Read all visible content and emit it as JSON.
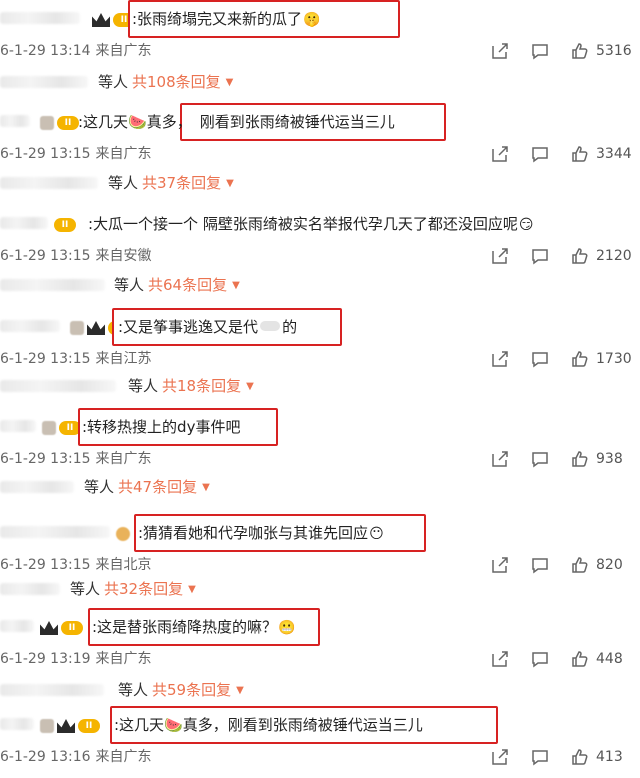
{
  "comments": [
    {
      "text": ":张雨绮塌完又来新的瓜了",
      "emoji": "🤫",
      "date": "6-1-29 13:14",
      "source": "来自广东",
      "likes": "5316",
      "reply_prefix": "等人",
      "reply_count": "共108条回复"
    },
    {
      "text": ":这几天🍉真多，",
      "highlight": "刚看到张雨绮被锤代运当三儿",
      "date": "6-1-29 13:15",
      "source": "来自广东",
      "likes": "3344",
      "reply_prefix": "等人",
      "reply_count": "共37条回复"
    },
    {
      "text": ":大瓜一个接一个 隔壁张雨绮被实名举报代孕几天了都还没回应呢",
      "emoji": "😏",
      "date": "6-1-29 13:15",
      "source": "来自安徽",
      "likes": "2120",
      "reply_prefix": "等人",
      "reply_count": "共64条回复"
    },
    {
      "text": ":又是筝事逃逸又是代",
      "text_tail": "的",
      "date": "6-1-29 13:15",
      "source": "来自江苏",
      "likes": "1730",
      "reply_prefix": "等人",
      "reply_count": "共18条回复"
    },
    {
      "text": ":转移热搜上的dy事件吧",
      "date": "6-1-29 13:15",
      "source": "来自广东",
      "likes": "938",
      "reply_prefix": "等人",
      "reply_count": "共47条回复"
    },
    {
      "text": ":猜猜看她和代孕咖张与其谁先回应",
      "emoji": "😶",
      "date": "6-1-29 13:15",
      "source": "来自北京",
      "likes": "820",
      "reply_prefix": "等人",
      "reply_count": "共32条回复"
    },
    {
      "text": ":这是替张雨绮降热度的嘛？",
      "emoji": "😬",
      "date": "6-1-29 13:19",
      "source": "来自广东",
      "likes": "448",
      "reply_prefix": "等人",
      "reply_count": "共59条回复"
    },
    {
      "text": ":这几天🍉真多，刚看到张雨绮被锤代运当三儿",
      "date": "6-1-29 13:16",
      "source": "来自广东",
      "likes": "413"
    }
  ],
  "colors": {
    "highlight_border": "#d72222",
    "reply_link": "#eb7350",
    "badge": "#f5b400"
  },
  "icons": {
    "share": "share-icon",
    "comment": "comment-icon",
    "like": "thumbs-up-icon",
    "caret": "chevron-down-icon"
  }
}
